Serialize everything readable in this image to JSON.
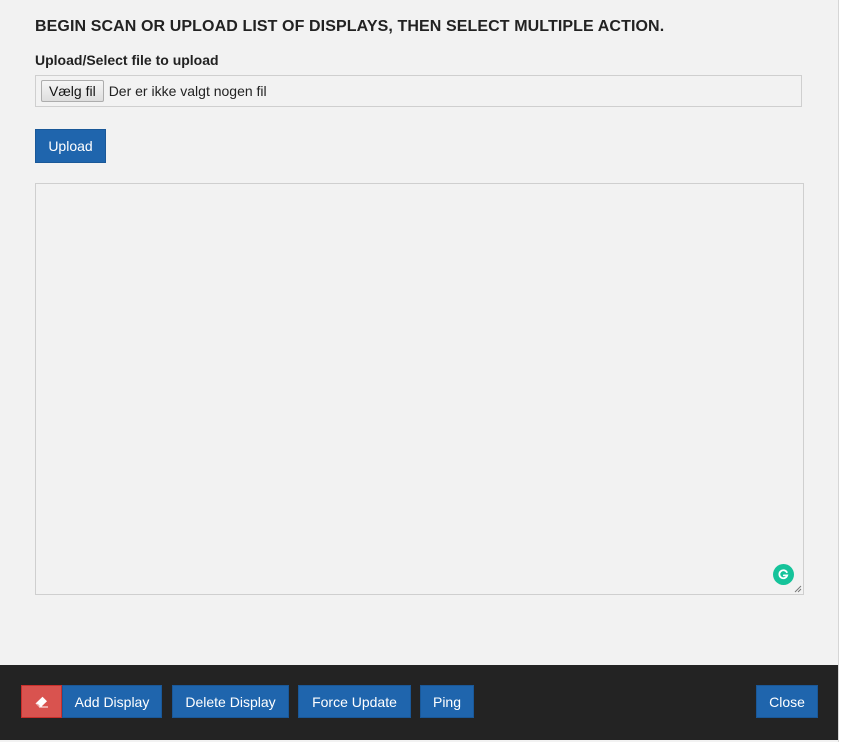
{
  "modal": {
    "title": "BEGIN SCAN OR UPLOAD LIST OF DISPLAYS, THEN SELECT MULTIPLE ACTION.",
    "upload_label": "Upload/Select file to upload",
    "file_input": {
      "button_label": "Vælg fil",
      "status_text": "Der er ikke valgt nogen fil"
    },
    "upload_button": "Upload",
    "textarea": {
      "value": "",
      "grammarly_icon": "grammarly-icon"
    }
  },
  "footer": {
    "eraser_icon": "eraser-icon",
    "buttons": {
      "add_display": "Add Display",
      "delete_display": "Delete Display",
      "force_update": "Force Update",
      "ping": "Ping",
      "close": "Close"
    }
  },
  "colors": {
    "primary": "#1f65ad",
    "danger": "#d9534f",
    "footer_bg": "#232323",
    "modal_bg": "#f2f2f2",
    "grammarly": "#15c39a"
  }
}
